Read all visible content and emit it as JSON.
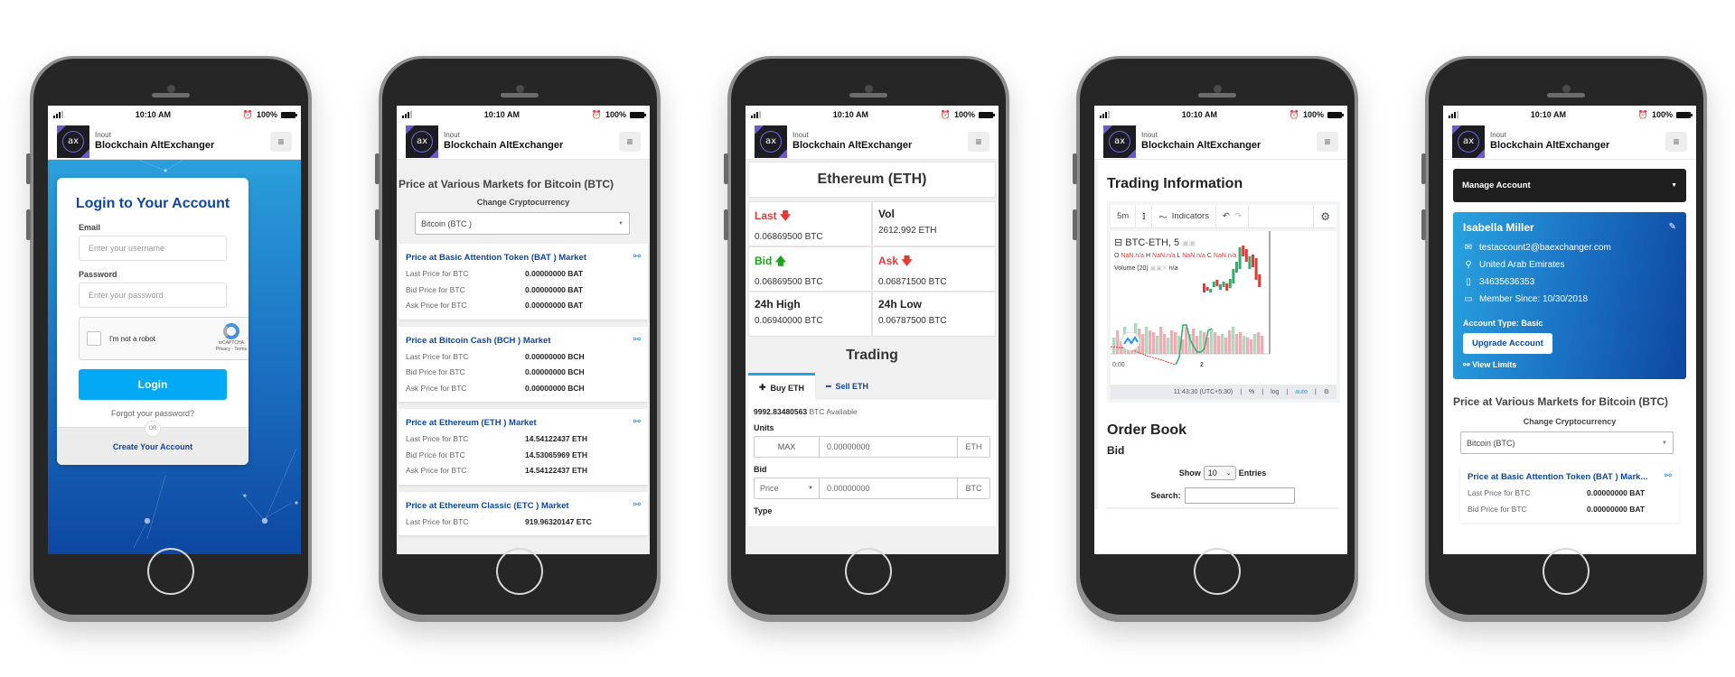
{
  "status_bar": {
    "time": "10:10 AM",
    "battery": "100%"
  },
  "header": {
    "brand_sub": "Inout",
    "brand_name": "Blockchain AltExchanger",
    "logo_text": "ax",
    "menu_icon": "hamburger-icon"
  },
  "colors": {
    "primary": "#0d47a1",
    "accent": "#03a9f4",
    "red": "#e53935",
    "green": "#19a519",
    "dark": "#1f1f1f"
  },
  "login": {
    "title": "Login to Your Account",
    "email_label": "Email",
    "email_placeholder": "Enter your username",
    "password_label": "Password",
    "password_placeholder": "Enter your password",
    "captcha_label": "I'm not a robot",
    "captcha_brand": "reCAPTCHA",
    "captcha_links": "Privacy - Terms",
    "login_button": "Login",
    "forgot": "Forgot your password?",
    "or": "OR",
    "create": "Create Your Account"
  },
  "markets": {
    "title": "Price at Various Markets for Bitcoin (BTC)",
    "change_label": "Change Cryptocurrency",
    "selected": "Bitcoin (BTC )",
    "cards": [
      {
        "title": "Price at Basic Attention Token (BAT ) Market",
        "rows": [
          {
            "k": "Last Price for BTC",
            "v": "0.00000000 BAT"
          },
          {
            "k": "Bid Price for BTC",
            "v": "0.00000000 BAT"
          },
          {
            "k": "Ask Price for BTC",
            "v": "0.00000000 BAT"
          }
        ]
      },
      {
        "title": "Price at Bitcoin Cash (BCH ) Market",
        "rows": [
          {
            "k": "Last Price for BTC",
            "v": "0.00000000 BCH"
          },
          {
            "k": "Bid Price for BTC",
            "v": "0.00000000 BCH"
          },
          {
            "k": "Ask Price for BTC",
            "v": "0.00000000 BCH"
          }
        ]
      },
      {
        "title": "Price at Ethereum (ETH ) Market",
        "rows": [
          {
            "k": "Last Price for BTC",
            "v": "14.54122437 ETH"
          },
          {
            "k": "Bid Price for BTC",
            "v": "14.53065969 ETH"
          },
          {
            "k": "Ask Price for BTC",
            "v": "14.54122437 ETH"
          }
        ]
      },
      {
        "title": "Price at Ethereum Classic (ETC ) Market",
        "rows": [
          {
            "k": "Last Price for BTC",
            "v": "919.96320147 ETC"
          }
        ]
      }
    ]
  },
  "ticker": {
    "title": "Ethereum (ETH)",
    "stats": [
      {
        "label": "Last",
        "value": "0.06869500 BTC",
        "trend": "down"
      },
      {
        "label": "Vol",
        "value": "2612.992 ETH",
        "trend": "none"
      },
      {
        "label": "Bid",
        "value": "0.06869500 BTC",
        "trend": "up"
      },
      {
        "label": "Ask",
        "value": "0.06871500 BTC",
        "trend": "down"
      },
      {
        "label": "24h High",
        "value": "0.06940000 BTC",
        "trend": "none"
      },
      {
        "label": "24h Low",
        "value": "0.06787500 BTC",
        "trend": "none"
      }
    ],
    "trading_title": "Trading",
    "tabs": [
      {
        "label": "Buy ETH",
        "icon": "+",
        "active": true
      },
      {
        "label": "Sell ETH",
        "icon": "−",
        "active": false
      }
    ],
    "available_amount": "9992.83480563",
    "available_suffix": "BTC Available",
    "units_label": "Units",
    "max_label": "MAX",
    "units_value": "0.00000000",
    "units_currency": "ETH",
    "bid_label": "Bid",
    "bid_type": "Price",
    "bid_value": "0.00000000",
    "bid_currency": "BTC",
    "type_label": "Type"
  },
  "trading_info": {
    "title": "Trading Information",
    "toolbar": {
      "interval": "5m",
      "indicators": "Indicators"
    },
    "symbol": "BTC-ETH, 5",
    "ohlc": {
      "o": "NaN.n/a",
      "h": "NaN.n/a",
      "l": "NaN.n/a",
      "c": "NaN.n/a"
    },
    "volume_label": "Volume (20)",
    "volume_value": "n/a",
    "x_ticks": [
      "0:00",
      "2"
    ],
    "footer": {
      "time": "11:43:30 (UTC+5:30)",
      "percent": "%",
      "log": "log",
      "auto": "auto"
    },
    "order_book_title": "Order Book",
    "order_book_sub": "Bid",
    "show_label": "Show",
    "entries_value": "10",
    "entries_label": "Entries",
    "search_label": "Search:"
  },
  "account": {
    "manage_label": "Manage Account",
    "name": "Isabella Miller",
    "email": "testaccount2@baexchanger.com",
    "country": "United Arab Emirates",
    "phone": "34635636353",
    "member_since": "Member Since: 10/30/2018",
    "account_type": "Account Type: Basic",
    "upgrade": "Upgrade Account",
    "view_limits": "View Limits",
    "markets_title": "Price at Various Markets for Bitcoin (BTC)",
    "change_label": "Change Cryptocurrency",
    "selected": "Bitcoin (BTC)",
    "card_title": "Price at Basic Attention Token (BAT ) Mark...",
    "rows": [
      {
        "k": "Last Price for BTC",
        "v": "0.00000000 BAT"
      },
      {
        "k": "Bid Price for BTC",
        "v": "0.00000000 BAT"
      }
    ]
  }
}
